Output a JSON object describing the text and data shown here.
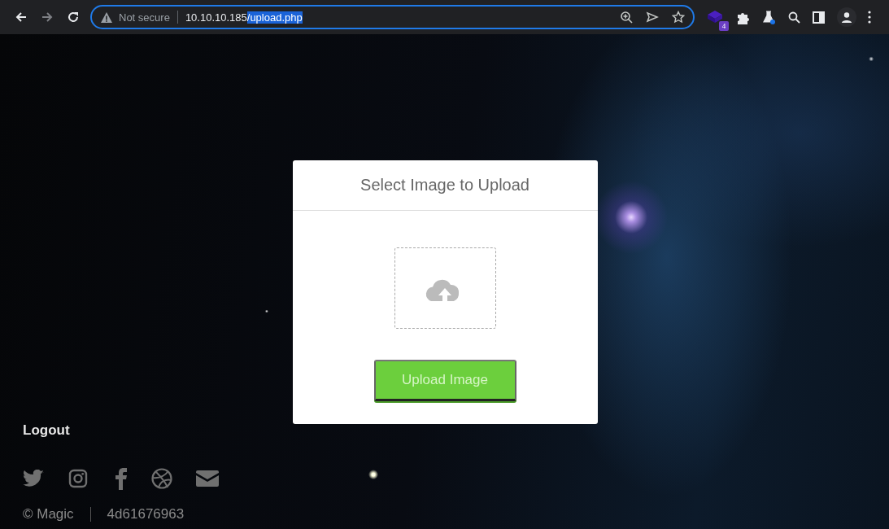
{
  "browser": {
    "back_disabled": false,
    "forward_disabled": true,
    "security_label": "Not secure",
    "url_host": "10.10.10.185",
    "url_path": "/upload.php",
    "url_path_selected": true,
    "extension_badge": "4"
  },
  "upload_card": {
    "title": "Select Image to Upload",
    "button": "Upload Image"
  },
  "footer": {
    "logout": "Logout",
    "copyright": "© Magic",
    "code": "4d61676963"
  }
}
